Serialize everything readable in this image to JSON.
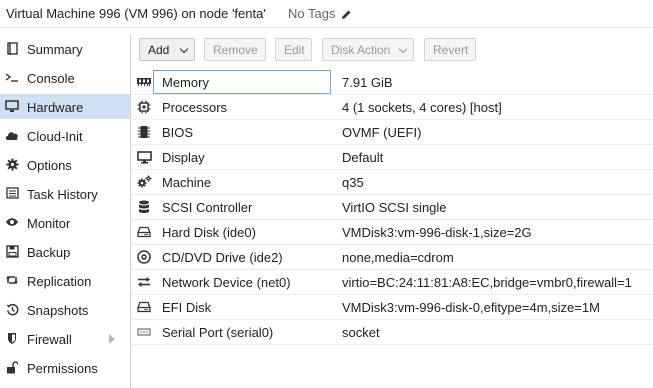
{
  "header": {
    "title": "Virtual Machine 996 (VM 996) on node 'fenta'",
    "tags": "No Tags"
  },
  "sidebar": {
    "items": [
      {
        "label": "Summary",
        "icon": "book-icon"
      },
      {
        "label": "Console",
        "icon": "terminal-icon"
      },
      {
        "label": "Hardware",
        "icon": "monitor-icon",
        "active": true
      },
      {
        "label": "Cloud-Init",
        "icon": "cloud-icon"
      },
      {
        "label": "Options",
        "icon": "gear-icon"
      },
      {
        "label": "Task History",
        "icon": "list-icon"
      },
      {
        "label": "Monitor",
        "icon": "eye-icon"
      },
      {
        "label": "Backup",
        "icon": "floppy-icon"
      },
      {
        "label": "Replication",
        "icon": "retweet-icon"
      },
      {
        "label": "Snapshots",
        "icon": "history-icon"
      },
      {
        "label": "Firewall",
        "icon": "shield-icon"
      },
      {
        "label": "Permissions",
        "icon": "unlock-icon"
      }
    ]
  },
  "toolbar": {
    "add": "Add",
    "remove": "Remove",
    "edit": "Edit",
    "disk_action": "Disk Action",
    "revert": "Revert"
  },
  "hardware": [
    {
      "key": "Memory",
      "value": "7.91 GiB",
      "icon": "memory-icon"
    },
    {
      "key": "Processors",
      "value": "4 (1 sockets, 4 cores) [host]",
      "icon": "cpu-icon"
    },
    {
      "key": "BIOS",
      "value": "OVMF (UEFI)",
      "icon": "microchip-icon"
    },
    {
      "key": "Display",
      "value": "Default",
      "icon": "desktop-icon"
    },
    {
      "key": "Machine",
      "value": "q35",
      "icon": "cogs-icon"
    },
    {
      "key": "SCSI Controller",
      "value": "VirtIO SCSI single",
      "icon": "database-icon"
    },
    {
      "key": "Hard Disk (ide0)",
      "value": "VMDisk3:vm-996-disk-1,size=2G",
      "icon": "hdd-icon"
    },
    {
      "key": "CD/DVD Drive (ide2)",
      "value": "none,media=cdrom",
      "icon": "cdrom-icon"
    },
    {
      "key": "Network Device (net0)",
      "value": "virtio=BC:24:11:81:A8:EC,bridge=vmbr0,firewall=1",
      "icon": "exchange-icon"
    },
    {
      "key": "EFI Disk",
      "value": "VMDisk3:vm-996-disk-0,efitype=4m,size=1M",
      "icon": "hdd-icon"
    },
    {
      "key": "Serial Port (serial0)",
      "value": "socket",
      "icon": "serial-icon"
    }
  ]
}
